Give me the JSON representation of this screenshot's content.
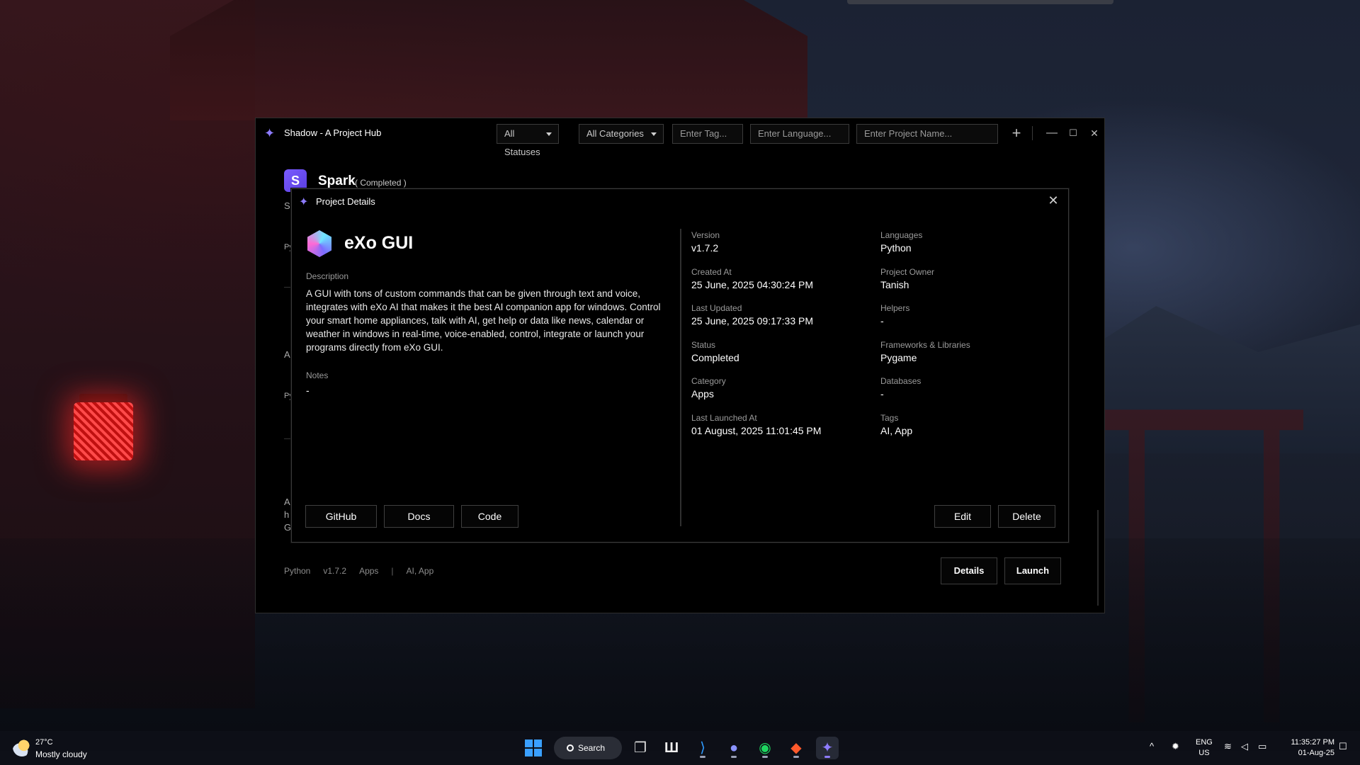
{
  "app": {
    "title": "Shadow - A Project Hub",
    "filters": {
      "status": "All Statuses",
      "category": "All Categories",
      "tag_placeholder": "Enter Tag...",
      "language_placeholder": "Enter Language...",
      "name_placeholder": "Enter Project Name..."
    },
    "add_glyph": "+",
    "window_controls": {
      "minimize": "—",
      "maximize": "☐",
      "close": "✕"
    }
  },
  "background_card": {
    "avatar_letter": "S",
    "name": "Spark",
    "status": "( Completed )",
    "fragments": [
      "S",
      "Py",
      "A",
      "Py",
      "A",
      "h",
      "G"
    ],
    "footer": {
      "language": "Python",
      "version": "v1.7.2",
      "category": "Apps",
      "separator": "|",
      "tags": "AI, App"
    },
    "details_button": "Details",
    "launch_button": "Launch"
  },
  "dialog": {
    "title": "Project Details",
    "project_name": "eXo GUI",
    "description_label": "Description",
    "description": "A GUI with tons of custom commands that can be given through text and voice, integrates with eXo AI that makes it the best AI companion app for windows. Control your smart home appliances, talk with AI, get help or data like news, calendar or weather in windows in real-time, voice-enabled, control, integrate or launch your programs directly from eXo GUI.",
    "notes_label": "Notes",
    "notes": "-",
    "fields_left": [
      {
        "label": "Version",
        "value": "v1.7.2"
      },
      {
        "label": "Created At",
        "value": "25 June, 2025 04:30:24 PM"
      },
      {
        "label": "Last Updated",
        "value": "25 June, 2025 09:17:33 PM"
      },
      {
        "label": "Status",
        "value": "Completed"
      },
      {
        "label": "Category",
        "value": "Apps"
      },
      {
        "label": "Last Launched At",
        "value": "01 August, 2025 11:01:45 PM"
      }
    ],
    "fields_right": [
      {
        "label": "Languages",
        "value": "Python"
      },
      {
        "label": "Project Owner",
        "value": "Tanish"
      },
      {
        "label": "Helpers",
        "value": "-"
      },
      {
        "label": "Frameworks & Libraries",
        "value": "Pygame"
      },
      {
        "label": "Databases",
        "value": "-"
      },
      {
        "label": "Tags",
        "value": "AI, App"
      }
    ],
    "buttons": {
      "github": "GitHub",
      "docs": "Docs",
      "code": "Code",
      "edit": "Edit",
      "delete": "Delete"
    }
  },
  "taskbar": {
    "weather_temp": "27°C",
    "weather_desc": "Mostly cloudy",
    "search": "Search",
    "lang_line1": "ENG",
    "lang_line2": "US",
    "time": "11:35:27 PM",
    "date": "01-Aug-25"
  },
  "colors": {
    "accent": "#8e7cff",
    "dialog_bg": "#000000",
    "border": "#3a3a3a"
  }
}
